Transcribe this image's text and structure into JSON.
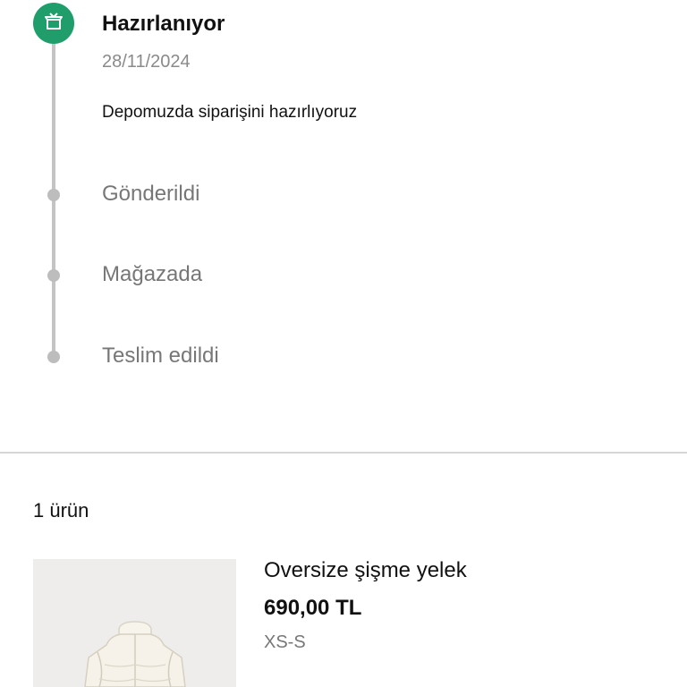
{
  "timeline": {
    "current": {
      "icon": "package-icon",
      "title": "Hazırlanıyor",
      "date": "28/11/2024",
      "description": "Depomuzda siparişini hazırlıyoruz",
      "accent_color": "#1f9d6a"
    },
    "pending": [
      {
        "label": "Gönderildi"
      },
      {
        "label": "Mağazada"
      },
      {
        "label": "Teslim edildi"
      }
    ]
  },
  "items": {
    "count_label": "1 ürün",
    "products": [
      {
        "name": "Oversize şişme yelek",
        "price": "690,00 TL",
        "size": "XS-S",
        "image": "white-puffer-vest"
      }
    ]
  }
}
